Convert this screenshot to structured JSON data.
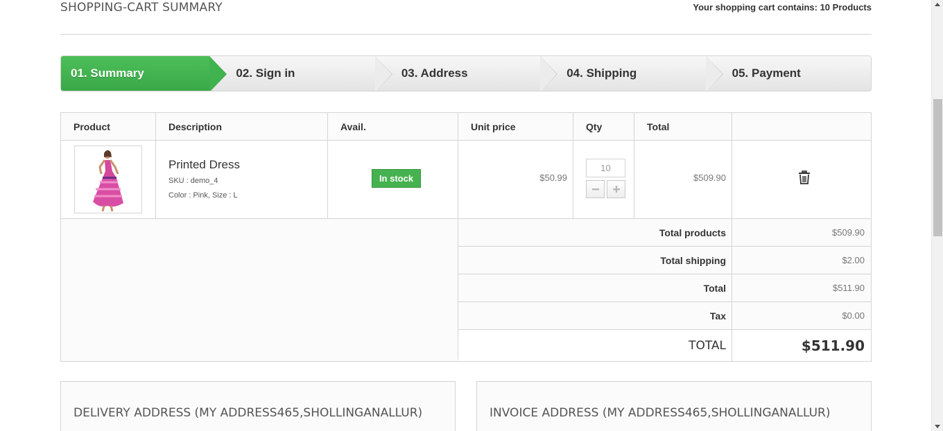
{
  "header": {
    "title": "SHOPPING-CART SUMMARY",
    "count_label": "Your shopping cart contains: 10 Products"
  },
  "steps": [
    {
      "label": "01. Summary",
      "current": true
    },
    {
      "label": "02. Sign in",
      "current": false
    },
    {
      "label": "03. Address",
      "current": false
    },
    {
      "label": "04. Shipping",
      "current": false
    },
    {
      "label": "05. Payment",
      "current": false
    }
  ],
  "table": {
    "columns": [
      "Product",
      "Description",
      "Avail.",
      "Unit price",
      "Qty",
      "Total",
      ""
    ],
    "items": [
      {
        "image_icon": "dress-thumbnail",
        "name": "Printed Dress",
        "sku": "SKU : demo_4",
        "attributes": "Color : Pink, Size : L",
        "availability": "In stock",
        "unit_price": "$50.99",
        "qty": "10",
        "total": "$509.90",
        "delete_icon": "trash-icon"
      }
    ]
  },
  "totals": {
    "total_products_label": "Total products",
    "total_products_value": "$509.90",
    "total_shipping_label": "Total shipping",
    "total_shipping_value": "$2.00",
    "total_label": "Total",
    "total_value": "$511.90",
    "tax_label": "Tax",
    "tax_value": "$0.00",
    "grand_label": "TOTAL",
    "grand_value": "$511.90"
  },
  "addresses": {
    "delivery_heading": "DELIVERY ADDRESS (MY ADDRESS465,SHOLLINGANALLUR)",
    "invoice_heading": "INVOICE ADDRESS (MY ADDRESS465,SHOLLINGANALLUR)"
  },
  "colors": {
    "accent": "#46b24f",
    "border": "#d6d4d4",
    "heading": "#555454"
  }
}
